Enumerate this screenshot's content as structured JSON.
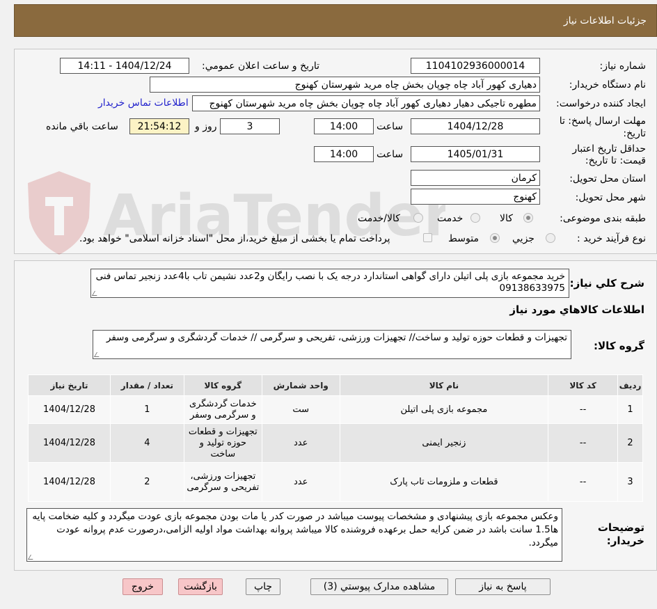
{
  "header": {
    "title": "جزئيات اطلاعات نياز"
  },
  "watermark": {
    "text": "AriaTender.neT"
  },
  "form": {
    "need_number_label": "شماره نياز:",
    "need_number": "1104102936000014",
    "announce_label": "تاريخ و ساعت اعلان عمومي:",
    "announce_value": "1404/12/24 - 14:11",
    "buyer_org_label": "نام دستگاه خريدار:",
    "buyer_org": "دهیاری کهور آباد چاه چوپان بخش چاه مرید شهرستان کهنوج",
    "creator_label": "ايجاد كننده درخواست:",
    "creator": "مطهره تاجیکی دهیار دهیاری کهور آباد چاه چوپان بخش چاه مرید شهرستان کهنوج",
    "contact_link": "اطلاعات تماس خريدار",
    "deadline_label_1": "مهلت ارسال پاسخ: تا",
    "deadline_label_2": "تاريخ:",
    "deadline_date": "1404/12/28",
    "time_label": "ساعت",
    "deadline_time": "14:00",
    "days_value": "3",
    "days_label": "روز و",
    "remaining_time": "21:54:12",
    "remaining_label": "ساعت باقي مانده",
    "validity_label_1": "حداقل تاريخ اعتبار",
    "validity_label_2": "قيمت: تا تاريخ:",
    "validity_date": "1405/01/31",
    "validity_time": "14:00",
    "province_label": "استان محل تحويل:",
    "province": "كرمان",
    "city_label": "شهر محل تحويل:",
    "city": "کهنوج",
    "category_label": "طبقه بندی موضوعی:",
    "category_options": [
      "كالا",
      "خدمت",
      "كالا/خدمت"
    ],
    "category_selected": "كالا",
    "purchase_type_label": "نوع فرآيند خريد :",
    "purchase_options": [
      "جزيي",
      "متوسط"
    ],
    "purchase_selected": "متوسط",
    "treasury_note": "پرداخت تمام يا بخشی از مبلغ خريد،از محل \"اسناد خزانه اسلامی\" خواهد بود."
  },
  "description": {
    "label": "شرح كلي نياز:",
    "text": "خرید مجموعه بازی پلی اتیلن دارای گواهی استاندارد درجه یک با نصب رایگان و2عدد نشیمن تاب با4عدد زنجیر تماس فنی 09138633975"
  },
  "goods_info_title": "اطلاعات كالاهاي مورد نياز",
  "goods_group": {
    "label": "گروه کالا:",
    "text": "تجهیزات و قطعات حوزه تولید و ساخت// تجهیزات ورزشی، تفریحی و سرگرمی // خدمات گردشگری و سرگرمی وسفر"
  },
  "table": {
    "headers": [
      "رديف",
      "كد كالا",
      "نام كالا",
      "واحد شمارش",
      "گروه كالا",
      "تعداد / مقدار",
      "تاريخ نياز"
    ],
    "rows": [
      [
        "1",
        "--",
        "مجموعه بازی پلی اتیلن",
        "ست",
        "خدمات گردشگری و سرگرمی وسفر",
        "1",
        "1404/12/28"
      ],
      [
        "2",
        "--",
        "زنجیر ایمنی",
        "عدد",
        "تجهیزات و قطعات حوزه تولید و ساخت",
        "4",
        "1404/12/28"
      ],
      [
        "3",
        "--",
        "قطعات و ملزومات تاب پارک",
        "عدد",
        "تجهیزات ورزشی، تفریحی و سرگرمی",
        "2",
        "1404/12/28"
      ]
    ]
  },
  "buyer_notes": {
    "label_1": "توضيحات",
    "label_2": "خريدار:",
    "text": "وعکس مجموعه بازی پیشنهادی و مشخصات پیوست میباشد در صورت کدر یا مات بودن مجموعه بازی عودت میگردد و کلیه ضخامت پایه ها1.5 سانت باشد در ضمن کرایه حمل برعهده فروشنده کالا میباشد پروانه بهداشت مواد اولیه الزامی،درصورت عدم پروانه عودت میگردد."
  },
  "buttons": {
    "reply": "پاسخ به نياز",
    "attachments": "مشاهده مدارک پيوستي (3)",
    "print": "چاپ",
    "back": "بازگشت",
    "exit": "خروج"
  }
}
